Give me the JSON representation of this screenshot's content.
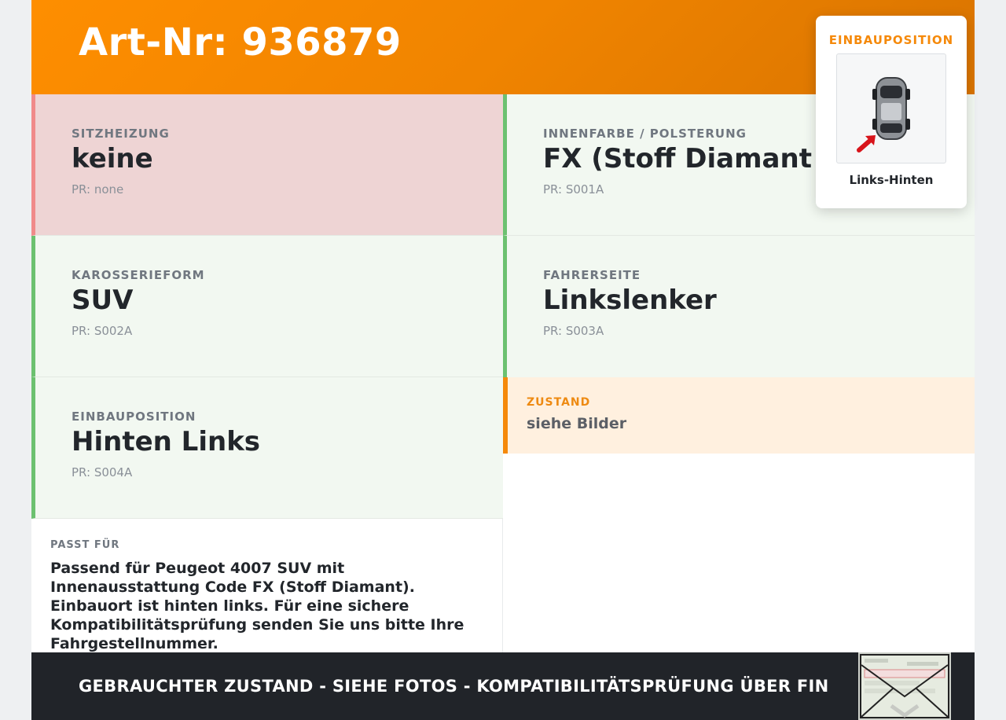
{
  "header": {
    "art_nr": "Art-Nr: 936879"
  },
  "cells": [
    {
      "label": "SITZHEIZUNG",
      "value": "keine",
      "pr": "PR: none"
    },
    {
      "label": "INNENFARBE / POLSTERUNG",
      "value": "FX (Stoff Diamant XA)",
      "pr": "PR: S001A"
    },
    {
      "label": "KAROSSERIEFORM",
      "value": "SUV",
      "pr": "PR: S002A"
    },
    {
      "label": "FAHRERSEITE",
      "value": "Linkslenker",
      "pr": "PR: S003A"
    },
    {
      "label": "EINBAUPOSITION",
      "value": "Hinten Links",
      "pr": "PR: S004A"
    }
  ],
  "zustand": {
    "label": "ZUSTAND",
    "value": "siehe Bilder"
  },
  "passt": {
    "label": "PASST FÜR",
    "text": "Passend für Peugeot 4007 SUV mit Innenausstattung Code FX (Stoff Diamant). Einbauort ist hinten links. Für eine sichere Kompatibilitätsprüfung senden Sie uns bitte Ihre Fahrgestellnummer."
  },
  "footer": {
    "text": "GEBRAUCHTER ZUSTAND - SIEHE FOTOS - KOMPATIBILITÄTSPRÜFUNG ÜBER FIN"
  },
  "popup": {
    "title": "EINBAUPOSITION",
    "caption": "Links-Hinten"
  },
  "colors": {
    "accent": "#f5890a",
    "ok_border": "#6cc170",
    "ok_bg": "#f2f8f1",
    "warn_border": "#f08a8a",
    "warn_bg": "#eed4d4",
    "footer_bg": "#212429"
  }
}
